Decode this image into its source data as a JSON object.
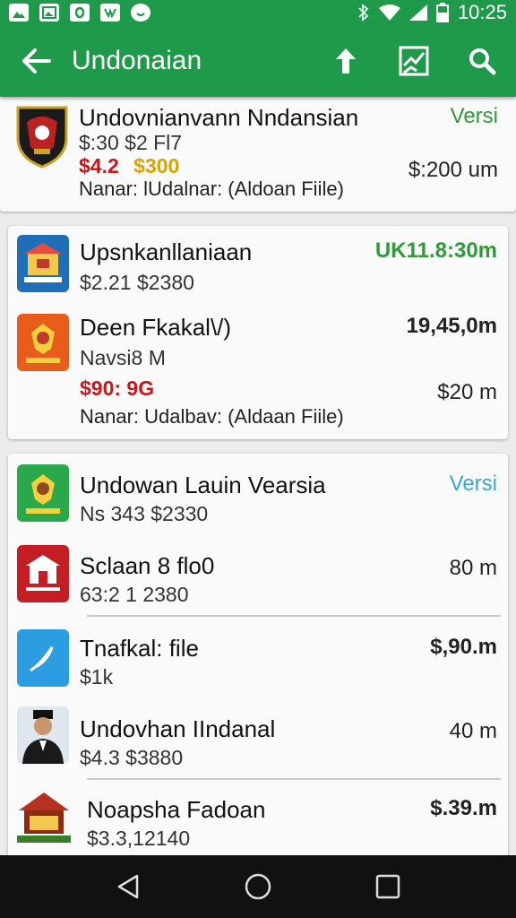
{
  "status_bar": {
    "time": "10:25",
    "icons": [
      "picture-icon",
      "image-icon",
      "o-app-icon",
      "link-icon",
      "smiley-icon"
    ]
  },
  "app_bar": {
    "title": "Undonaian",
    "back_icon": "arrow-left-icon",
    "actions": [
      "upload-icon",
      "check-chart-icon",
      "search-icon"
    ]
  },
  "colors": {
    "primary": "#1f9a4a",
    "green_text": "#2e9a3a",
    "blue_text": "#3aa7cf",
    "red_text": "#c4181c",
    "gold_text": "#d9a300"
  },
  "cards": [
    {
      "items": [
        {
          "title": "Undovnianvann Nndansian",
          "line1": "$:30 $2 Fl7",
          "price_red": "$4.2",
          "price_gold": "$300",
          "meta": "Nanar: lUdalnar: (Aldoan Fiile)",
          "right_top": "Versi",
          "right_bottom": "$:200 um"
        }
      ]
    },
    {
      "items": [
        {
          "title": "Upsnkanllaniaan",
          "line1": "$2.21 $2380",
          "right_top": "UK11.8:30m"
        },
        {
          "title": "Deen Fkakal\\/)",
          "line1": "Navsi8 M",
          "price_red": "$90: 9G",
          "meta": "Nanar: Udalbav: (Aldaan Fiile)",
          "right_top": "19,45,0m",
          "right_bottom": "$20 m"
        }
      ]
    },
    {
      "items": [
        {
          "title": "Undowan Lauin Vearsia",
          "line1": "Ns 343 $2330",
          "right_top": "Versi"
        },
        {
          "title": "Sclaan 8 flo0",
          "line1": "63:2 1 2380",
          "right_top": "80 m"
        },
        {
          "title": "Tnafkal: file",
          "line1": "$1k",
          "right_top": "$,90.m"
        },
        {
          "title": "Undovhan IIndanal",
          "line1": "$4.3  $3880",
          "right_top": "40 m"
        },
        {
          "title": "Noapsha Fadoan",
          "line1": "$3.3,12140",
          "right_top": "$.39.m"
        }
      ]
    }
  ],
  "nav_bar": {
    "buttons": [
      "back-triangle-icon",
      "home-circle-icon",
      "recents-square-icon"
    ]
  }
}
